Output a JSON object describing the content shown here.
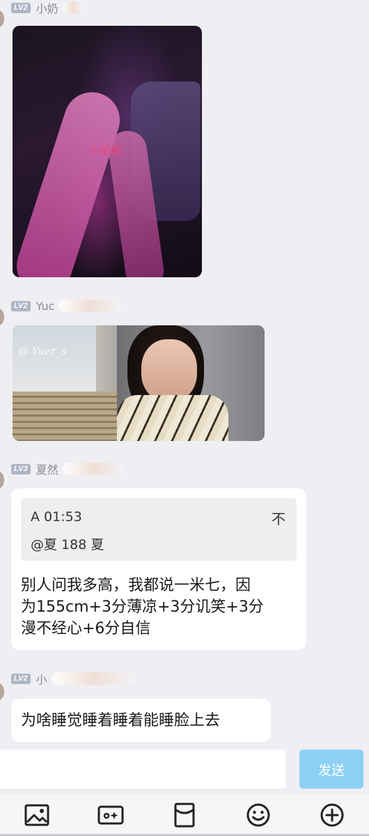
{
  "messages": [
    {
      "level": "LV2",
      "nickname": "小奶",
      "type": "image",
      "image_watermark": "小奶橘"
    },
    {
      "level": "LV2",
      "nickname": "Yuc",
      "type": "image",
      "image_watermark": "@ Yuer_s"
    },
    {
      "level": "LV3",
      "nickname": "夏然",
      "type": "text",
      "quote": {
        "time": "A 01:53",
        "pin_label": "不",
        "mention": "@夏 188 夏"
      },
      "text_lines": [
        "别人问我多高，我都说一米七，因",
        "为155cm+3分薄凉+3分讥笑+3分",
        "漫不经心+6分自信"
      ]
    },
    {
      "level": "LV2",
      "nickname": "小",
      "type": "text",
      "text_lines": [
        "为啥睡觉睡着睡着能睡脸上去"
      ]
    }
  ],
  "composer": {
    "input_value": "",
    "send_label": "发送",
    "send_color": "#8dd0f6"
  },
  "toolbar": {
    "icons": [
      "image-icon",
      "gif-icon",
      "red-packet-icon",
      "emoji-icon",
      "plus-icon"
    ]
  }
}
